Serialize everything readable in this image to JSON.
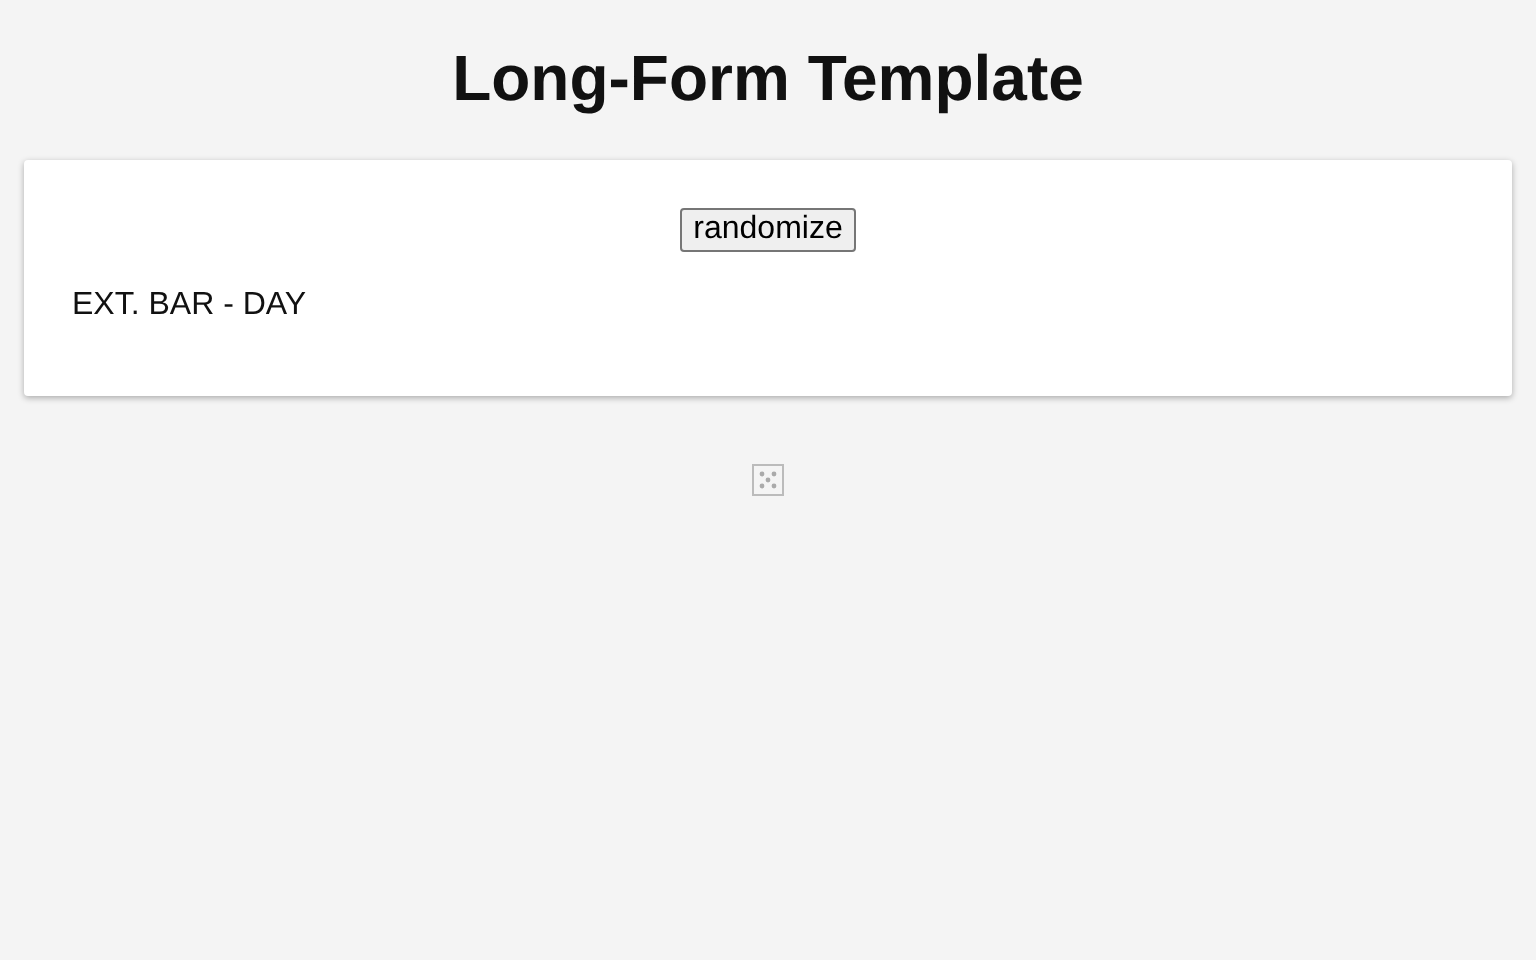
{
  "title": "Long-Form Template",
  "card": {
    "button": "randomize",
    "text": "EXT. BAR - DAY"
  }
}
